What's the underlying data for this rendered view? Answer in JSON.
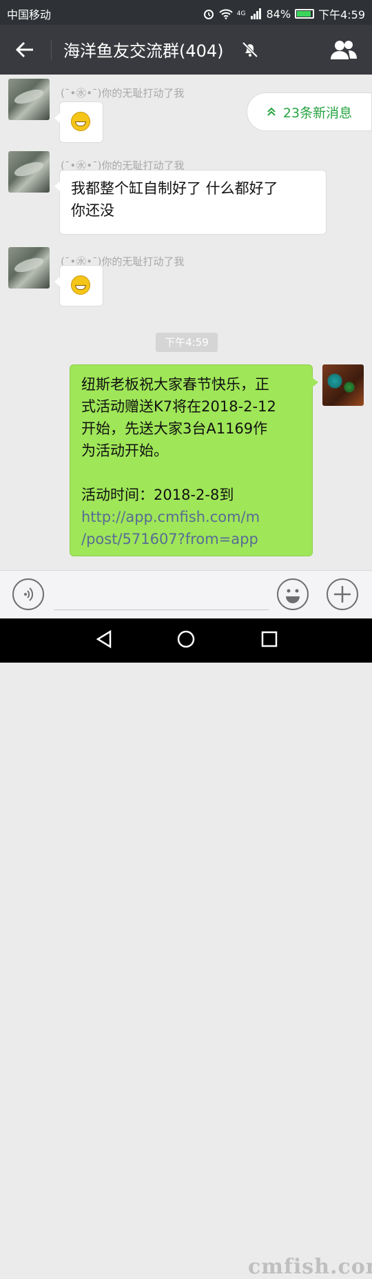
{
  "status_bar": {
    "carrier": "中国移动",
    "network": "4G",
    "battery_text": "84%",
    "battery_level": 0.84,
    "time": "下午4:59"
  },
  "nav": {
    "title": "海洋鱼友交流群(404)"
  },
  "messages": [
    {
      "sender": "(¯•㊌•¯)你的无耻打动了我",
      "type": "emoji"
    },
    {
      "sender": "(¯•㊌•¯)你的无耻打动了我",
      "type": "text",
      "lines": [
        "我都整个缸自制好了 什么都好了",
        "你还没"
      ]
    },
    {
      "sender": "(¯•㊌•¯)你的无耻打动了我",
      "type": "emoji"
    }
  ],
  "new_messages": "23条新消息",
  "timestamp": "下午4:59",
  "outgoing": {
    "lines": [
      "纽斯老板祝大家春节快乐，正",
      "式活动赠送K7将在2018-2-12",
      "开始，先送大家3台A1169作",
      "为活动开始。",
      "",
      "活动时间：2018-2-8到"
    ],
    "link_lines": [
      "http://app.cmfish.com/m",
      "/post/571607?from=app"
    ]
  },
  "watermark": "cmfish.com",
  "colors": {
    "accent_green": "#9fe658",
    "link": "#576b95",
    "new_msg_text": "#25a340"
  }
}
